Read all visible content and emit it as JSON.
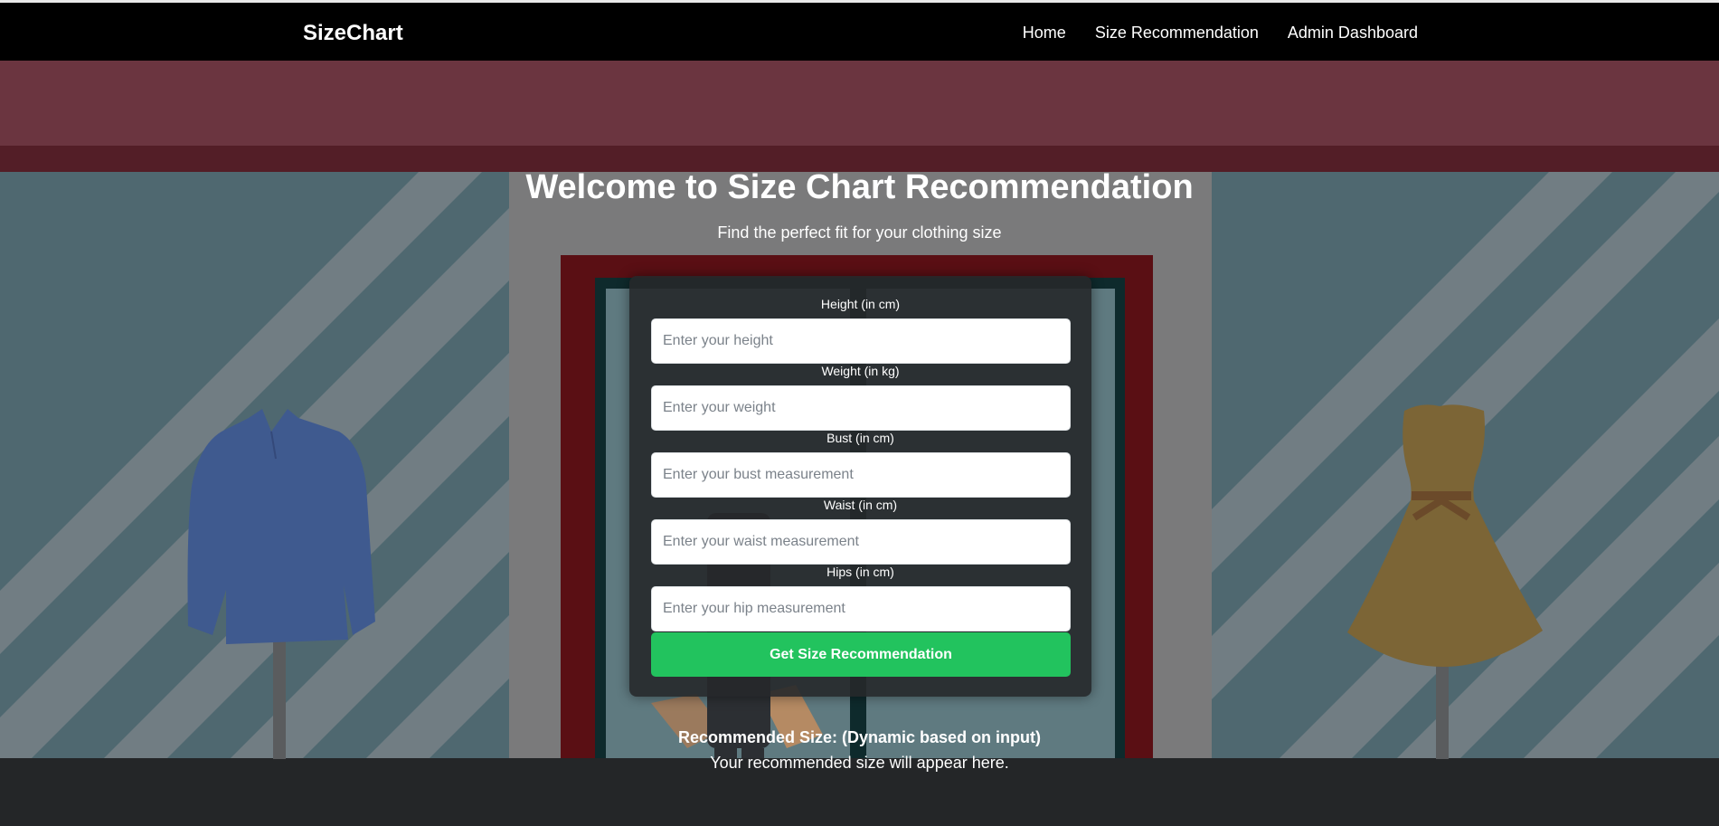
{
  "nav": {
    "brand": "SizeChart",
    "links": [
      "Home",
      "Size Recommendation",
      "Admin Dashboard"
    ]
  },
  "hero": {
    "title": "Welcome to Size Chart Recommendation",
    "subtitle": "Find the perfect fit for your clothing size"
  },
  "form": {
    "fields": [
      {
        "label": "Height (in cm)",
        "placeholder": "Enter your height",
        "value": ""
      },
      {
        "label": "Weight (in kg)",
        "placeholder": "Enter your weight",
        "value": ""
      },
      {
        "label": "Bust (in cm)",
        "placeholder": "Enter your bust measurement",
        "value": ""
      },
      {
        "label": "Waist (in cm)",
        "placeholder": "Enter your waist measurement",
        "value": ""
      },
      {
        "label": "Hips (in cm)",
        "placeholder": "Enter your hip measurement",
        "value": ""
      }
    ],
    "submit_label": "Get Size Recommendation"
  },
  "result": {
    "title": "Recommended Size: (Dynamic based on input)",
    "text": "Your recommended size will appear here."
  },
  "colors": {
    "navbar": "#000000",
    "accent_button": "#22c35e",
    "awning": "#6b3540",
    "wall": "#4f6870",
    "door_frame": "#5a0f14"
  },
  "icons": {
    "shirt": "shirt-mannequin-icon",
    "dress": "dress-mannequin-icon",
    "shopper": "shopper-figure-icon"
  }
}
